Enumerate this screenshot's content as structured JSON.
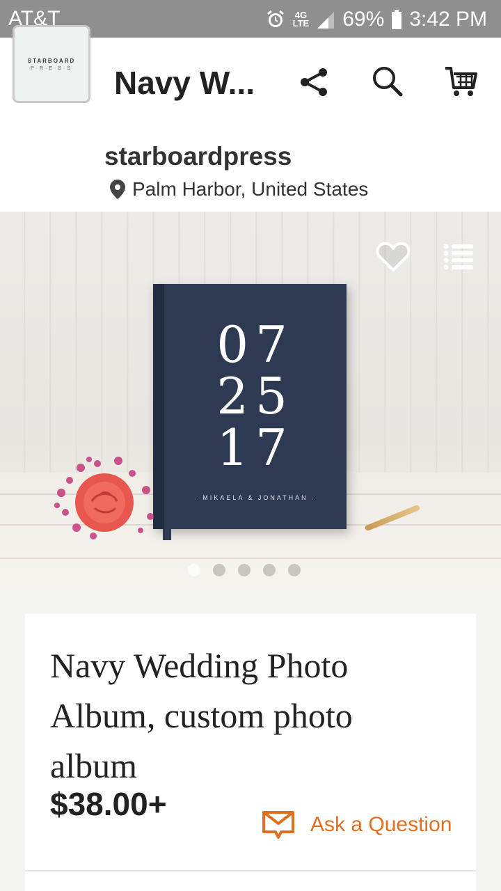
{
  "status_bar": {
    "carrier": "AT&T",
    "network": "4G LTE",
    "battery": "69%",
    "time": "3:42 PM"
  },
  "app_bar": {
    "title": "Navy W..."
  },
  "shop": {
    "name": "starboardpress",
    "location": "Palm Harbor, United States",
    "logo_line1": "STARBOARD",
    "logo_line2": "P·R·E·S·S"
  },
  "image": {
    "book_date": [
      "07",
      "25",
      "17"
    ],
    "book_names": "· MIKAELA & JONATHAN ·",
    "carousel_total": 5,
    "carousel_active": 1
  },
  "product": {
    "title": "Navy Wedding Photo Album, custom photo album",
    "price": "$38.00+",
    "ask_label": "Ask a Question"
  },
  "colors": {
    "accent": "#e0701f",
    "status_bar": "#8f8f8f",
    "book": "#2e3a52"
  }
}
